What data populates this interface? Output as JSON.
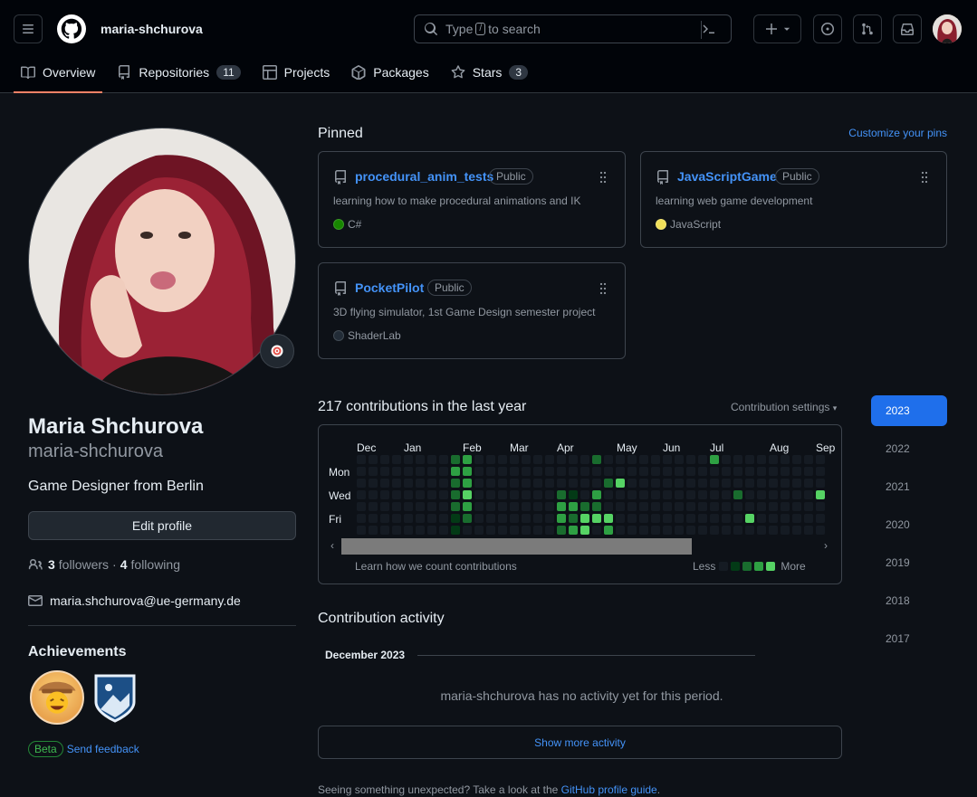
{
  "header": {
    "username": "maria-shchurova",
    "search": {
      "prefix": "Type",
      "key": "/",
      "suffix": "to search"
    },
    "tabs": [
      {
        "label": "Overview",
        "icon": "book-icon"
      },
      {
        "label": "Repositories",
        "count": "11",
        "icon": "repo-icon"
      },
      {
        "label": "Projects",
        "icon": "table-icon"
      },
      {
        "label": "Packages",
        "icon": "package-icon"
      },
      {
        "label": "Stars",
        "count": "3",
        "icon": "star-icon"
      }
    ]
  },
  "profile": {
    "name": "Maria Shchurova",
    "login": "maria-shchurova",
    "bio": "Game Designer from Berlin",
    "edit_label": "Edit profile",
    "followers_count": "3",
    "followers_label": "followers",
    "following_count": "4",
    "following_label": "following",
    "separator": "·",
    "email": "maria.shchurova@ue-germany.de",
    "achievements_title": "Achievements",
    "beta_label": "Beta",
    "feedback_label": "Send feedback"
  },
  "pinned": {
    "title": "Pinned",
    "customize_label": "Customize your pins",
    "repos": [
      {
        "name": "procedural_anim_tests",
        "visibility": "Public",
        "description": "learning how to make procedural animations and IK",
        "language": "C#",
        "language_color": "#178600"
      },
      {
        "name": "JavaScriptGame",
        "visibility": "Public",
        "description": "learning web game development",
        "language": "JavaScript",
        "language_color": "#f1e05a"
      },
      {
        "name": "PocketPilot",
        "visibility": "Public",
        "description": "3D flying simulator, 1st Game Design semester project",
        "language": "ShaderLab",
        "language_color": "#222c37"
      }
    ]
  },
  "contributions": {
    "title": "217 contributions in the last year",
    "settings_label": "Contribution settings",
    "months": [
      "Dec",
      "Jan",
      "Feb",
      "Mar",
      "Apr",
      "May",
      "Jun",
      "Jul",
      "Aug",
      "Sep"
    ],
    "days": [
      "Mon",
      "Wed",
      "Fri"
    ],
    "learn_label": "Learn how we count contributions",
    "less_label": "Less",
    "more_label": "More",
    "levels": [
      "#151b23",
      "#033a16",
      "#196c2e",
      "#2ea043",
      "#56d364"
    ],
    "years": [
      "2023",
      "2022",
      "2021",
      "2020",
      "2019",
      "2018",
      "2017"
    ],
    "active_year": "2023"
  },
  "activity": {
    "title": "Contribution activity",
    "month": "December 2023",
    "empty_text": "maria-shchurova has no activity yet for this period.",
    "show_more_label": "Show more activity",
    "footer_prefix": "Seeing something unexpected? Take a look at the",
    "footer_link": "GitHub profile guide",
    "footer_suffix": "."
  }
}
